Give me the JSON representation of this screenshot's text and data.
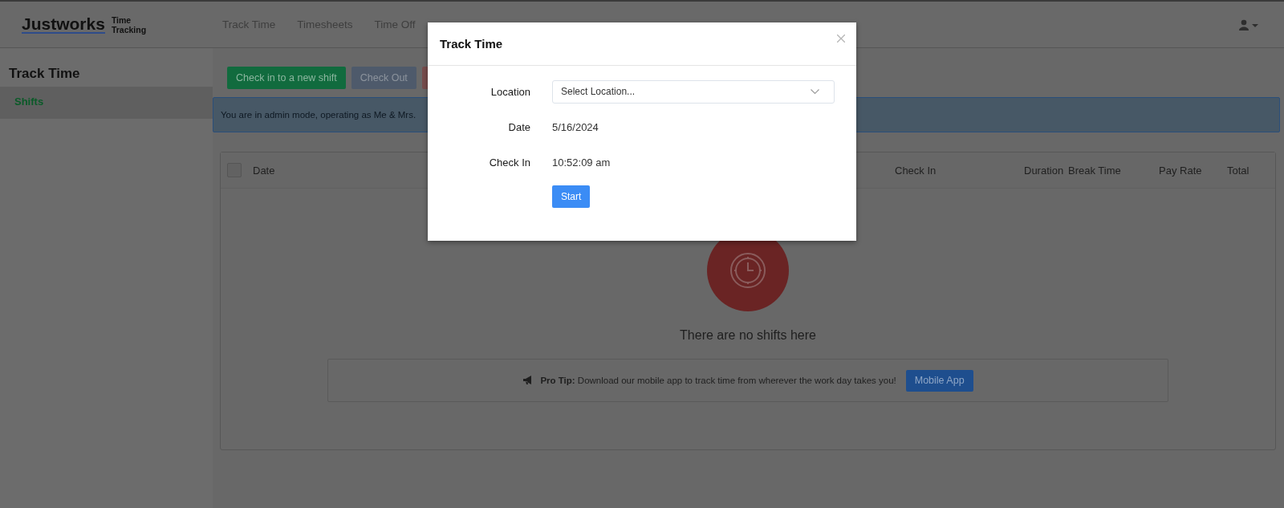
{
  "header": {
    "logo": "Justworks",
    "product": "Time Tracking",
    "nav": [
      "Track Time",
      "Timesheets",
      "Time Off"
    ]
  },
  "sidebar": {
    "title": "Track Time",
    "items": [
      {
        "label": "Shifts",
        "selected": true
      }
    ]
  },
  "toolbar": {
    "buttons": [
      {
        "kind": "primary",
        "label": "Check in to a new shift",
        "disabled": false
      },
      {
        "kind": "secondary",
        "label": "Check Out",
        "disabled": true
      },
      {
        "kind": "danger",
        "disabled": true
      }
    ]
  },
  "alert": {
    "text": "You are in admin mode, operating as Me & Mrs."
  },
  "table": {
    "select_all": {
      "checked": false
    },
    "columns": [
      "Date",
      "Check In",
      "Duration",
      "Break Time",
      "Pay Rate",
      "Total"
    ],
    "empty": {
      "message": "There are no shifts here"
    },
    "pro_tip": {
      "text": "**Pro Tip:** Download our mobile app to track time from wherever the work day takes you!",
      "button": "Mobile App"
    }
  },
  "modal": {
    "title": "Track Time",
    "fields": [
      {
        "kind": "select",
        "label": "Location",
        "placeholder": "Select Location..."
      },
      {
        "kind": "text",
        "label": "Date",
        "value": "5/16/2024"
      },
      {
        "kind": "text",
        "label": "Check In",
        "value": "10:52:09 am"
      }
    ],
    "submit": "Start"
  }
}
